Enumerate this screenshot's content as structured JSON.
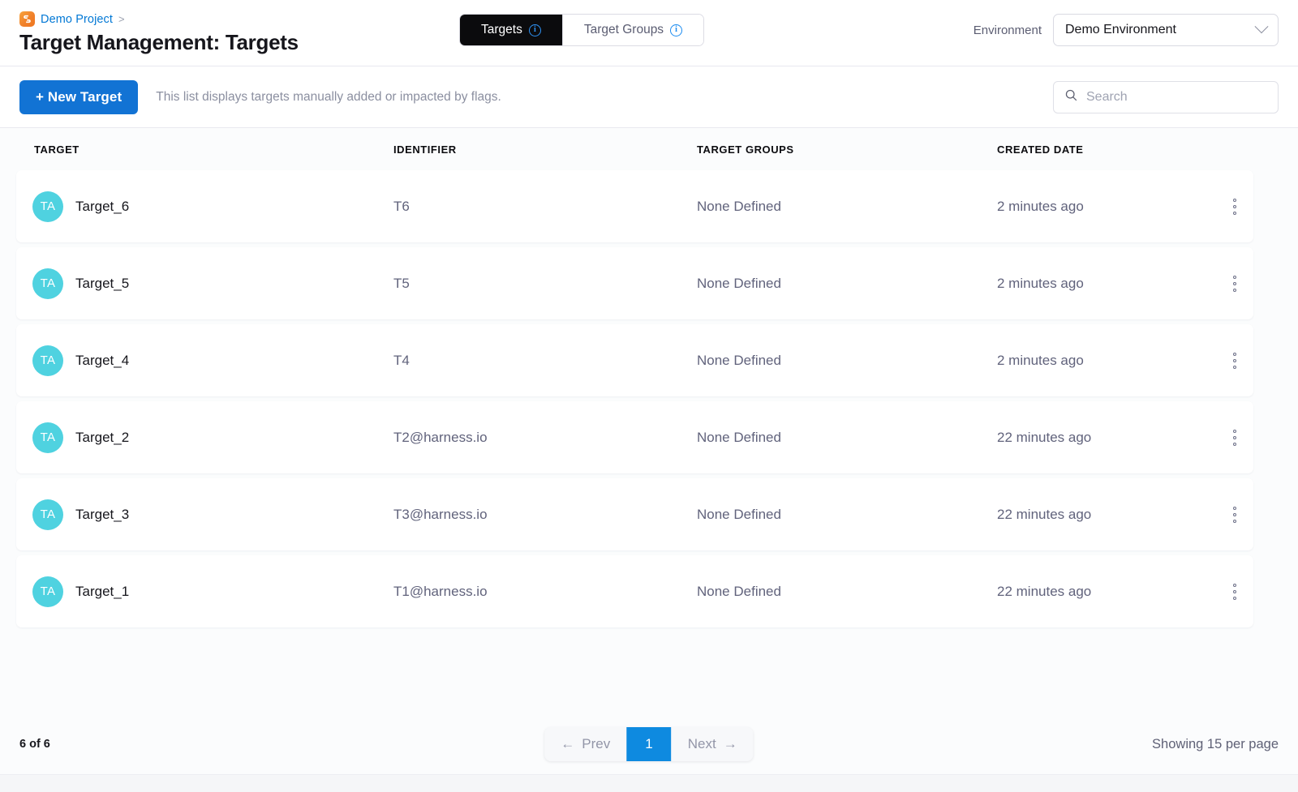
{
  "header": {
    "logo_icon": "harness-logo-icon",
    "breadcrumb_project": "Demo Project",
    "breadcrumb_separator": ">",
    "page_title": "Target Management: Targets",
    "tabs": [
      {
        "label": "Targets",
        "info_icon": "info-circle-icon",
        "active": true
      },
      {
        "label": "Target Groups",
        "info_icon": "info-circle-icon",
        "active": false
      }
    ],
    "environment_label": "Environment",
    "environment_value": "Demo Environment",
    "environment_chevron": "chevron-down-icon"
  },
  "toolbar": {
    "new_target_label": "+ New Target",
    "hint": "This list displays targets manually added or impacted by flags.",
    "search_placeholder": "Search",
    "search_value": "",
    "search_icon": "search-icon"
  },
  "table": {
    "columns": [
      "TARGET",
      "IDENTIFIER",
      "TARGET GROUPS",
      "CREATED DATE"
    ],
    "rows": [
      {
        "avatar": "TA",
        "target": "Target_6",
        "identifier": "T6",
        "groups": "None Defined",
        "created": "2 minutes ago"
      },
      {
        "avatar": "TA",
        "target": "Target_5",
        "identifier": "T5",
        "groups": "None Defined",
        "created": "2 minutes ago"
      },
      {
        "avatar": "TA",
        "target": "Target_4",
        "identifier": "T4",
        "groups": "None Defined",
        "created": "2 minutes ago"
      },
      {
        "avatar": "TA",
        "target": "Target_2",
        "identifier": "T2@harness.io",
        "groups": "None Defined",
        "created": "22 minutes ago"
      },
      {
        "avatar": "TA",
        "target": "Target_3",
        "identifier": "T3@harness.io",
        "groups": "None Defined",
        "created": "22 minutes ago"
      },
      {
        "avatar": "TA",
        "target": "Target_1",
        "identifier": "T1@harness.io",
        "groups": "None Defined",
        "created": "22 minutes ago"
      }
    ],
    "row_menu_icon": "kebab-menu-icon"
  },
  "footer": {
    "count": "6 of 6",
    "prev_label": "Prev",
    "prev_icon": "arrow-left-icon",
    "page_number": "1",
    "next_label": "Next",
    "next_icon": "arrow-right-icon",
    "showing": "Showing 15 per page"
  },
  "colors": {
    "primary_blue": "#1273d4",
    "link_blue": "#0278d5",
    "avatar_teal": "#4fd2e0",
    "tab_active_bg": "#0b0b0d",
    "page_bg": "#fbfcfd"
  }
}
